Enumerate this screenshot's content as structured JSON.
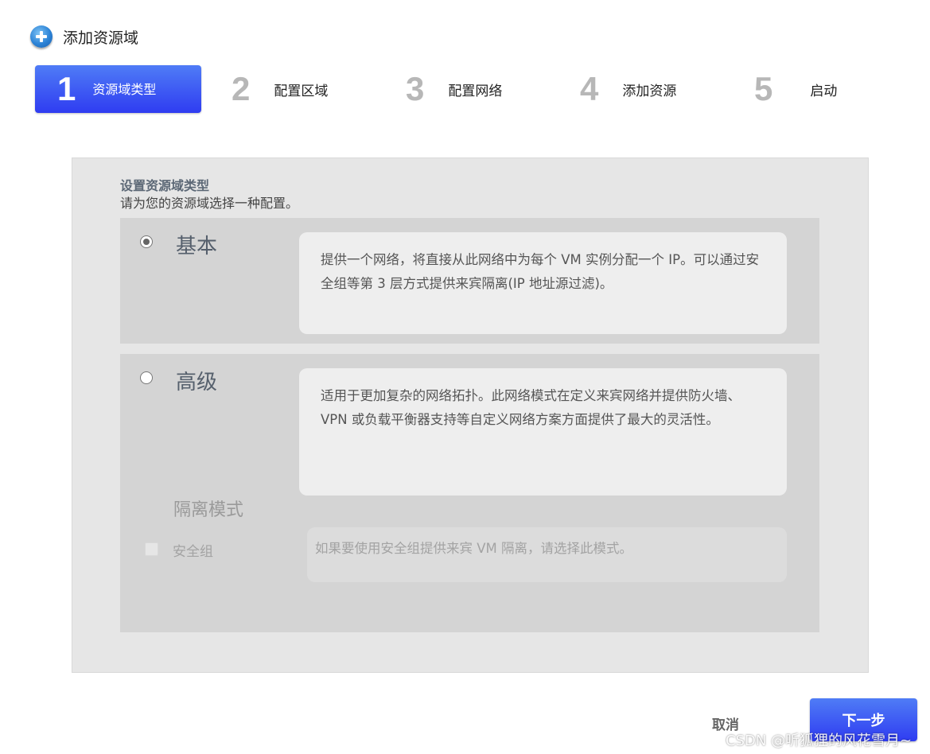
{
  "window": {
    "title": "添加资源域",
    "icon": "plus-circle-icon"
  },
  "steps": [
    {
      "number": "1",
      "label": "资源域类型",
      "active": true
    },
    {
      "number": "2",
      "label": "配置区域",
      "active": false
    },
    {
      "number": "3",
      "label": "配置网络",
      "active": false
    },
    {
      "number": "4",
      "label": "添加资源",
      "active": false
    },
    {
      "number": "5",
      "label": "启动",
      "active": false
    }
  ],
  "panel": {
    "heading": "设置资源域类型",
    "description": "请为您的资源域选择一种配置。"
  },
  "options": [
    {
      "title": "基本",
      "selected": true,
      "description": "提供一个网络，将直接从此网络中为每个 VM 实例分配一个 IP。可以通过安全组等第 3 层方式提供来宾隔离(IP 地址源过滤)。"
    },
    {
      "title": "高级",
      "selected": false,
      "description": "适用于更加复杂的网络拓扑。此网络模式在定义来宾网络并提供防火墙、VPN 或负载平衡器支持等自定义网络方案方面提供了最大的灵活性。"
    }
  ],
  "isolation": {
    "title": "隔离模式",
    "checkbox_label": "安全组",
    "checked": false,
    "description": "如果要使用安全组提供来宾 VM 隔离，请选择此模式。"
  },
  "footer": {
    "cancel_label": "取消",
    "next_label": "下一步"
  },
  "watermark": "CSDN @听狐狸的风花雪月~",
  "colors": {
    "accent": "#3a4ff2",
    "panel_bg": "#e6e6e6",
    "option_bg": "#d4d4d4"
  }
}
